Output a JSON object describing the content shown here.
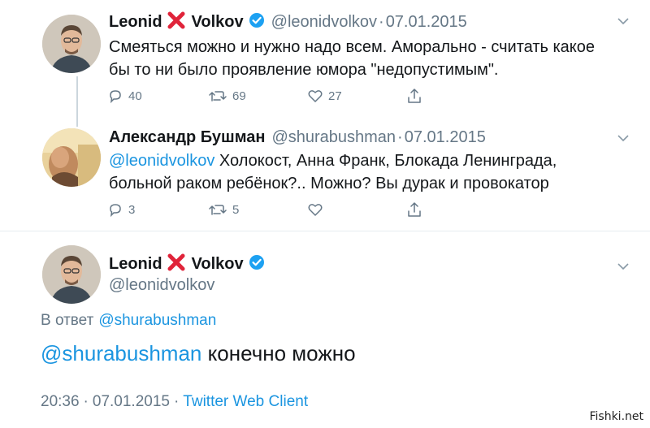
{
  "tweet1": {
    "name_first": "Leonid",
    "name_last": "Volkov",
    "handle": "@leonidvolkov",
    "sep": "·",
    "date": "07.01.2015",
    "text_line1": "Смеяться можно и нужно надо всем. Аморально - считать какое",
    "text_line2": "бы то ни было проявление юмора \"недопустимым\".",
    "replies": "40",
    "retweets": "69",
    "likes": "27"
  },
  "tweet2": {
    "name": "Александр Бушман",
    "handle": "@shurabushman",
    "sep": "·",
    "date": "07.01.2015",
    "mention": "@leonidvolkov",
    "text_line1_rest": " Холокост, Анна Франк, Блокада Ленинграда,",
    "text_line2": "больной раком ребёнок?.. Можно? Вы дурак и провокатор",
    "replies": "3",
    "retweets": "5"
  },
  "tweet3": {
    "name_first": "Leonid",
    "name_last": "Volkov",
    "handle": "@leonidvolkov",
    "reply_prefix": "В ответ",
    "reply_to": "@shurabushman",
    "mention": "@shurabushman",
    "text_rest": " конечно можно",
    "time": "20:36",
    "date": "07.01.2015",
    "client": "Twitter Web Client"
  },
  "watermark": "Fishki.net",
  "colors": {
    "link": "#1b95e0",
    "muted": "#657786",
    "red_x": "#e0243a",
    "verified": "#1da1f2"
  },
  "icons": [
    "reply-icon",
    "retweet-icon",
    "like-icon",
    "share-icon",
    "chevron-down-icon",
    "verified-icon",
    "red-x-icon"
  ]
}
